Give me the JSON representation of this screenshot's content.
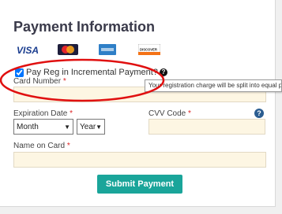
{
  "title": "Payment Information",
  "logos": {
    "visa": "VISA",
    "discover": "DISCOVER"
  },
  "pay_reg": {
    "label": "Pay Reg in Incremental Payment?",
    "help": "?",
    "checked": true
  },
  "tooltip": "Your registration charge will be split into equal p",
  "card_number": {
    "label": "Card Number",
    "required": "*"
  },
  "expiration": {
    "label": "Expiration Date",
    "required": "*",
    "month_value": "Month",
    "year_value": "Year"
  },
  "cvv": {
    "label": "CVV Code",
    "required": "*",
    "help": "?"
  },
  "name_on_card": {
    "label": "Name on Card",
    "required": "*"
  },
  "submit_label": "Submit Payment",
  "colors": {
    "button": "#1aa59a",
    "field_bg": "#fdf6e3",
    "required": "#dd2222",
    "annotation": "#e01010"
  }
}
